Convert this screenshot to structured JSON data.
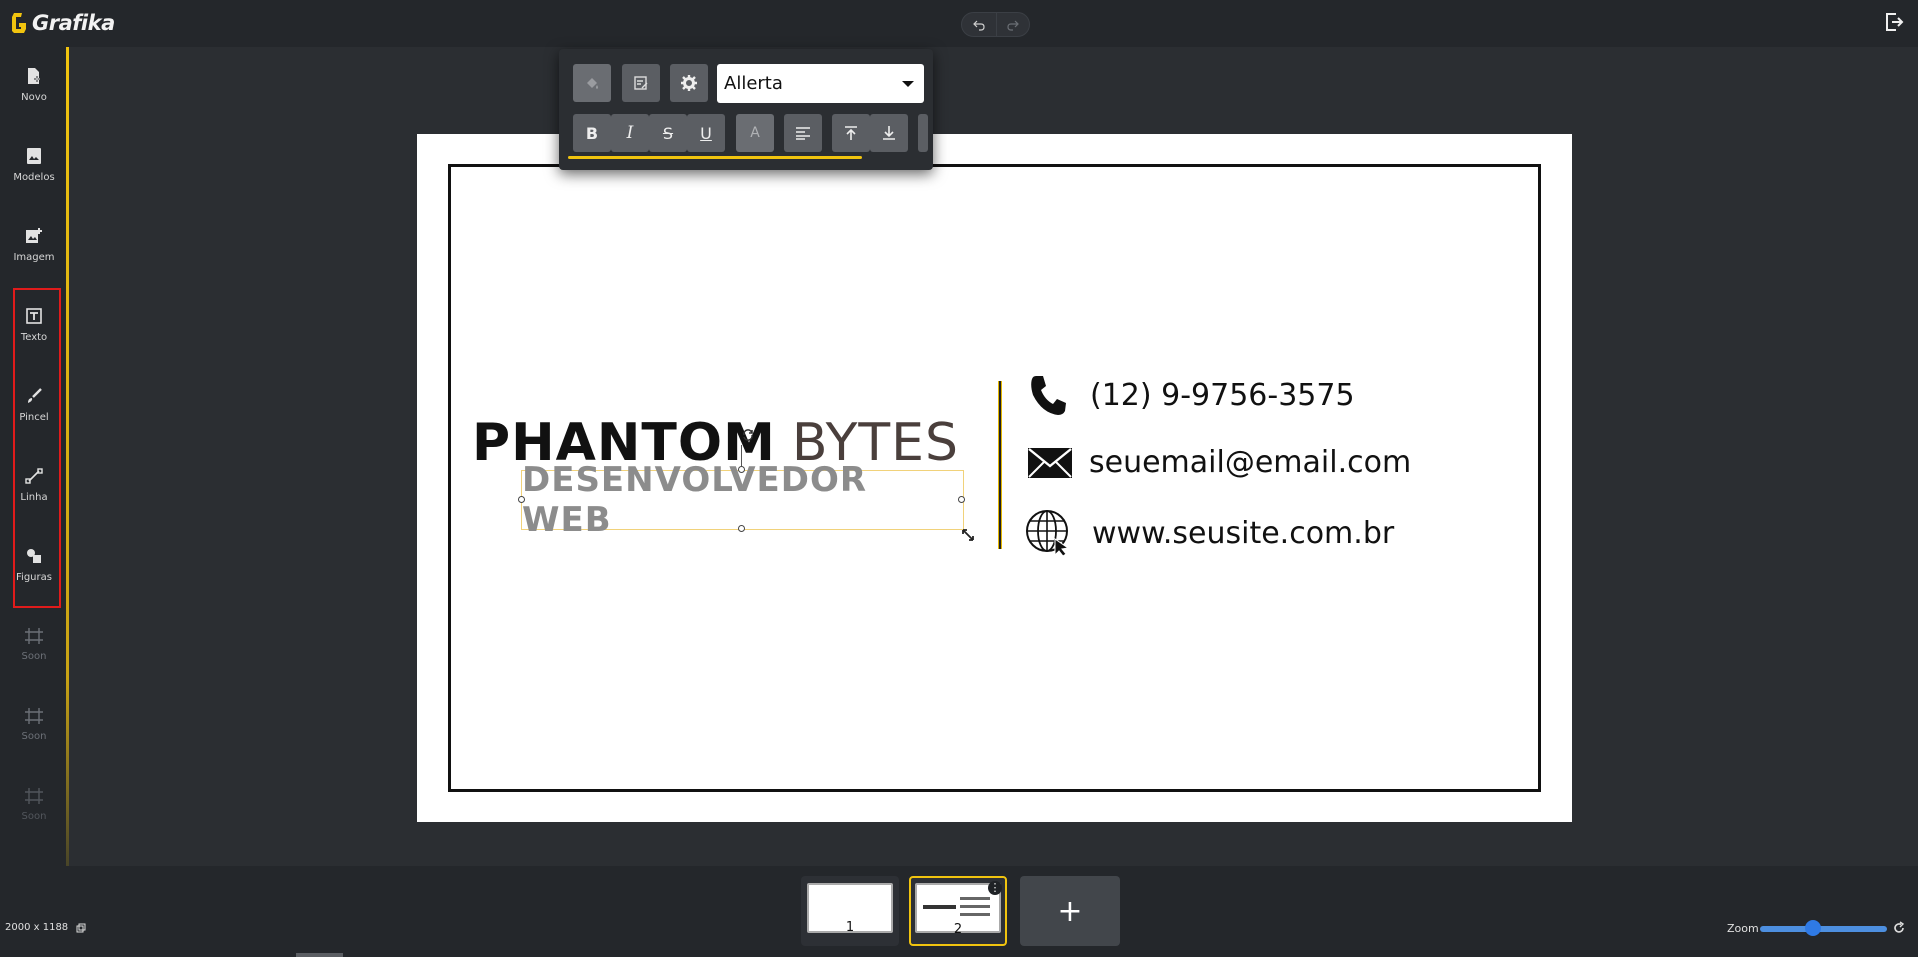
{
  "app": {
    "name": "Grafika"
  },
  "sidebar": {
    "items": [
      {
        "label": "Novo",
        "icon": "new-file-icon"
      },
      {
        "label": "Modelos",
        "icon": "templates-icon"
      },
      {
        "label": "Imagem",
        "icon": "add-image-icon"
      },
      {
        "label": "Texto",
        "icon": "text-box-icon"
      },
      {
        "label": "Pincel",
        "icon": "brush-icon"
      },
      {
        "label": "Linha",
        "icon": "line-icon"
      },
      {
        "label": "Figuras",
        "icon": "shapes-icon"
      },
      {
        "label": "Soon",
        "icon": "frame-icon"
      },
      {
        "label": "Soon",
        "icon": "frame-icon"
      },
      {
        "label": "Soon",
        "icon": "frame-icon"
      }
    ]
  },
  "text_toolbar": {
    "font": "Allerta",
    "buttons": [
      "fill-color",
      "text-style",
      "settings",
      "bold",
      "italic",
      "strikethrough",
      "underline",
      "font-size",
      "align-left",
      "align-top",
      "align-bottom"
    ]
  },
  "card": {
    "brand_primary": "PHANTOM",
    "brand_secondary": "BYTES",
    "subtitle": "DESENVOLVEDOR WEB",
    "phone": "(12) 9-9756-3575",
    "email": "seuemail@email.com",
    "website": "www.seusite.com.br"
  },
  "footer": {
    "dimensions": "2000 x 1188",
    "pages": [
      "1",
      "2"
    ],
    "active_page": "2",
    "add_label": "+",
    "zoom_label": "Zoom",
    "zoom_level": 0.42
  },
  "colors": {
    "accent": "#f1c40f",
    "highlight": "#e01b1b",
    "background": "#2b2e32"
  }
}
